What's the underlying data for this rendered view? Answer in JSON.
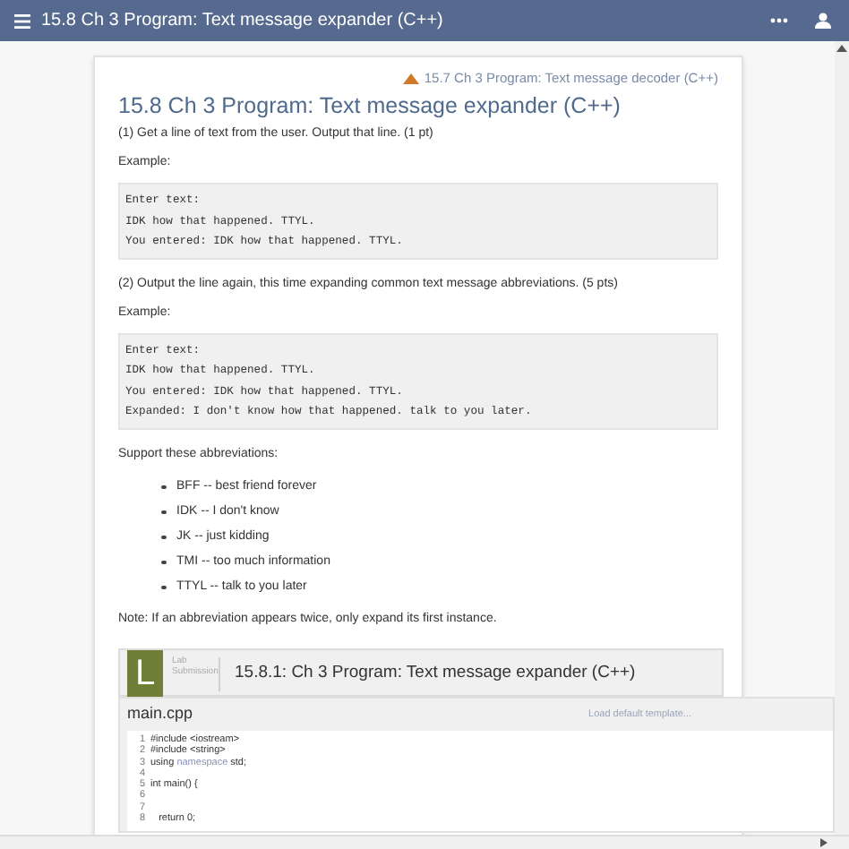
{
  "app_bar": {
    "title": "15.8 Ch 3 Program: Text message expander (C++)"
  },
  "nav_link": "15.7 Ch 3 Program: Text message decoder (C++)",
  "heading": "15.8 Ch 3 Program: Text message expander (C++)",
  "sections": [
    {
      "kind": "paragraph",
      "text": "(1) Get a line of text from the user. Output that line. (1 pt)"
    },
    {
      "kind": "paragraph",
      "text": "Example:"
    },
    {
      "kind": "example",
      "lines": [
        "Enter text:",
        "IDK how that happened. TTYL.",
        "You entered: IDK how that happened. TTYL."
      ]
    },
    {
      "kind": "paragraph",
      "text": "(2) Output the line again, this time expanding common text message abbreviations. (5 pts)"
    },
    {
      "kind": "paragraph",
      "text": "Example:"
    },
    {
      "kind": "example",
      "lines": [
        "Enter text:",
        "IDK how that happened. TTYL.",
        "You entered: IDK how that happened. TTYL.",
        "Expanded: I don't know how that happened. talk to you later."
      ]
    },
    {
      "kind": "paragraph",
      "text": "Support these abbreviations:"
    },
    {
      "kind": "list",
      "items": [
        "BFF -- best friend forever",
        "IDK -- I don't know",
        "JK -- just kidding",
        "TMI -- too much information",
        "TTYL -- talk to you later"
      ]
    },
    {
      "kind": "paragraph",
      "text": "Note: If an abbreviation appears twice, only expand its first instance."
    }
  ],
  "lab": {
    "badge": "L",
    "tag_lines": [
      "Lab",
      "Submission"
    ],
    "title": "15.8.1: Ch 3 Program: Text message expander (C++)"
  },
  "editor": {
    "filename": "main.cpp",
    "template_link": "Load default template...",
    "lines": [
      {
        "number": "1",
        "parts": [
          {
            "kind": "plain",
            "text": "#include <iostream>"
          }
        ]
      },
      {
        "number": "2",
        "parts": [
          {
            "kind": "plain",
            "text": "#include <string>"
          }
        ]
      },
      {
        "number": "3",
        "parts": [
          {
            "kind": "plain",
            "text": "using "
          },
          {
            "kind": "keyword",
            "text": "namespace"
          },
          {
            "kind": "plain",
            "text": " std;"
          }
        ]
      },
      {
        "number": "4"
      },
      {
        "number": "5",
        "parts": [
          {
            "kind": "plain",
            "text": "int main() {"
          }
        ]
      },
      {
        "number": "6"
      },
      {
        "number": "7"
      },
      {
        "number": "8",
        "parts": [
          {
            "kind": "plain",
            "text": "   return 0;"
          }
        ]
      }
    ]
  }
}
